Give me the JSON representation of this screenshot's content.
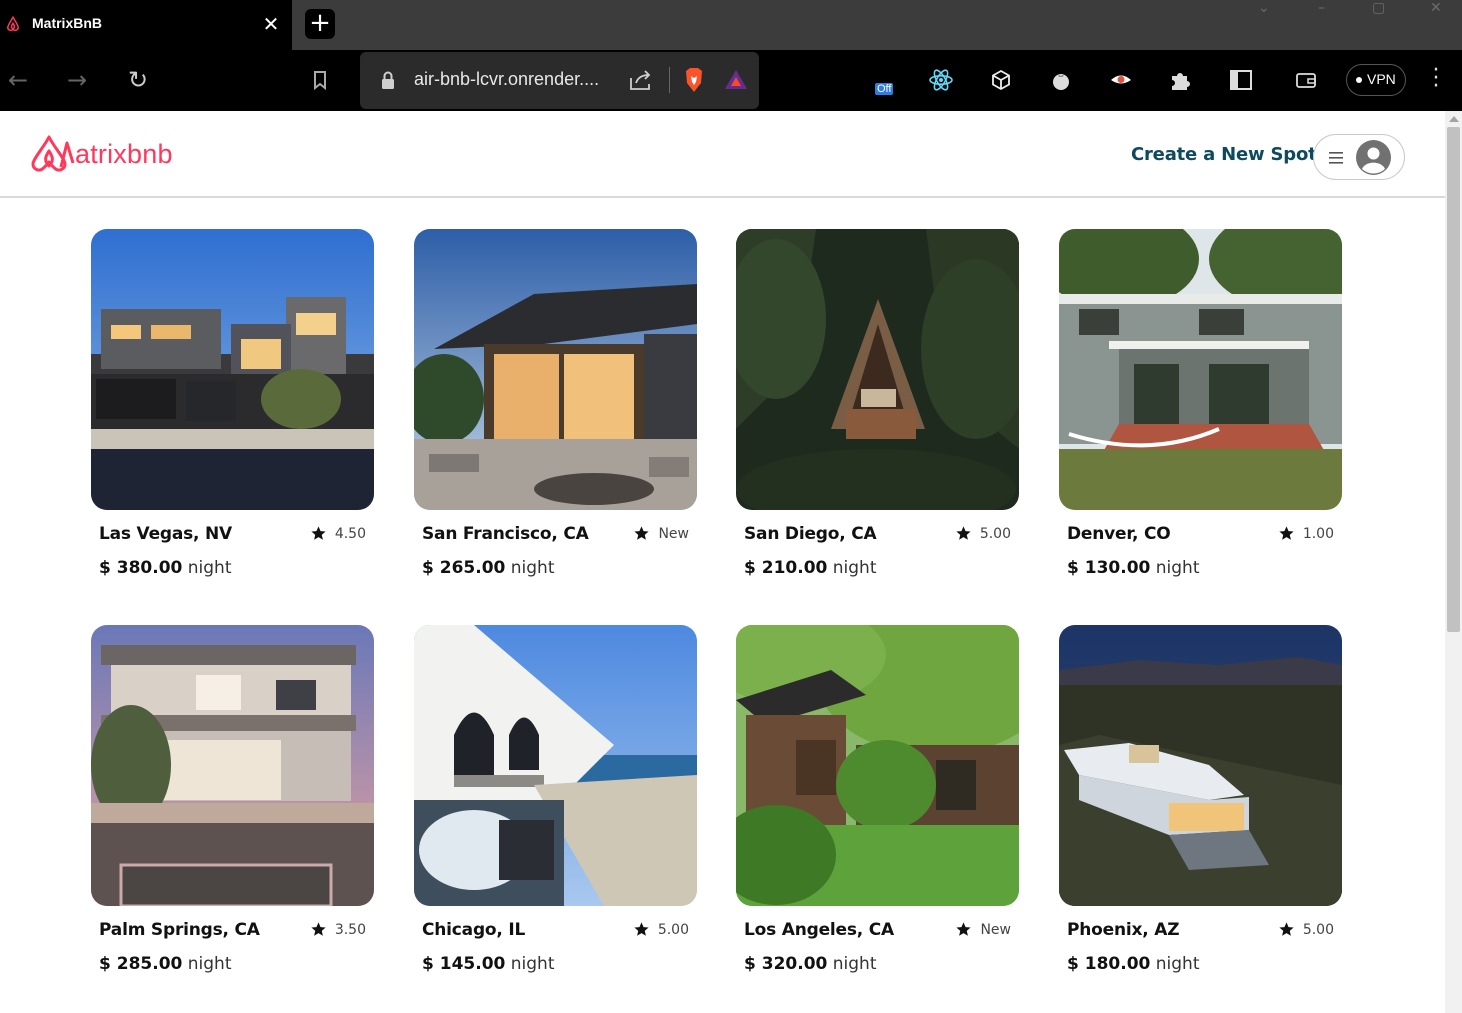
{
  "browser": {
    "tab_title": "MatrixBnB",
    "url": "air-bnb-lcvr.onrender....",
    "extension_badge": "Off",
    "vpn_label": "VPN"
  },
  "site": {
    "logo_text": "atrixbnb",
    "create_spot_label": "Create a New Spot",
    "accent_color": "#ff385c",
    "link_color": "#0e4a5e"
  },
  "listings": [
    {
      "city": "Las Vegas, NV",
      "rating": "4.50",
      "price": "$ 380.00",
      "unit": "night"
    },
    {
      "city": "San Francisco, CA",
      "rating": "New",
      "price": "$ 265.00",
      "unit": "night"
    },
    {
      "city": "San Diego, CA",
      "rating": "5.00",
      "price": "$ 210.00",
      "unit": "night"
    },
    {
      "city": "Denver, CO",
      "rating": "1.00",
      "price": "$ 130.00",
      "unit": "night"
    },
    {
      "city": "Palm Springs, CA",
      "rating": "3.50",
      "price": "$ 285.00",
      "unit": "night"
    },
    {
      "city": "Chicago, IL",
      "rating": "5.00",
      "price": "$ 145.00",
      "unit": "night"
    },
    {
      "city": "Los Angeles, CA",
      "rating": "New",
      "price": "$ 320.00",
      "unit": "night"
    },
    {
      "city": "Phoenix, AZ",
      "rating": "5.00",
      "price": "$ 180.00",
      "unit": "night"
    }
  ]
}
